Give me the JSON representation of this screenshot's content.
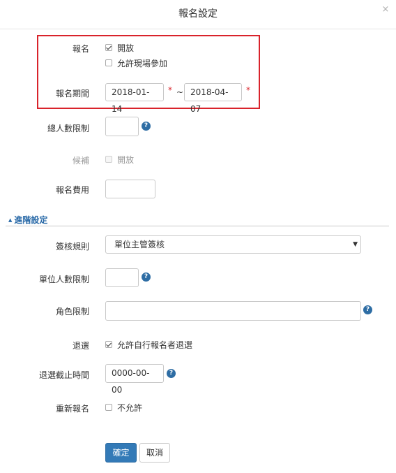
{
  "dialog": {
    "title": "報名設定",
    "close_icon": "×"
  },
  "registration": {
    "label": "報名",
    "open_checked": true,
    "open_label": "開放",
    "onsite_checked": false,
    "onsite_label": "允許現場參加"
  },
  "period": {
    "label": "報名期間",
    "start": "2018-01-14",
    "end": "2018-04-07",
    "separator": "~",
    "required_mark": "*"
  },
  "total_limit": {
    "label": "總人數限制",
    "value": ""
  },
  "waitlist": {
    "label": "候補",
    "open_checked": false,
    "open_label": "開放"
  },
  "fee": {
    "label": "報名費用",
    "value": ""
  },
  "advanced": {
    "title": "進階設定",
    "approval": {
      "label": "簽核規則",
      "selected": "單位主管簽核"
    },
    "unit_limit": {
      "label": "單位人數限制",
      "value": ""
    },
    "role_limit": {
      "label": "角色限制",
      "value": ""
    },
    "withdraw": {
      "label": "退選",
      "checked": true,
      "checkbox_label": "允許自行報名者退選"
    },
    "withdraw_deadline": {
      "label": "退選截止時間",
      "value": "0000-00-00"
    },
    "reregister": {
      "label": "重新報名",
      "checked": false,
      "checkbox_label": "不允許"
    }
  },
  "actions": {
    "confirm": "確定",
    "cancel": "取消"
  },
  "colors": {
    "primary": "#337ab7",
    "required": "#d9232b",
    "highlight_border": "#d9232b",
    "link": "#2a6aa8"
  },
  "icons": {
    "help": "?",
    "caret_up": "▲",
    "caret_down": "▼"
  }
}
